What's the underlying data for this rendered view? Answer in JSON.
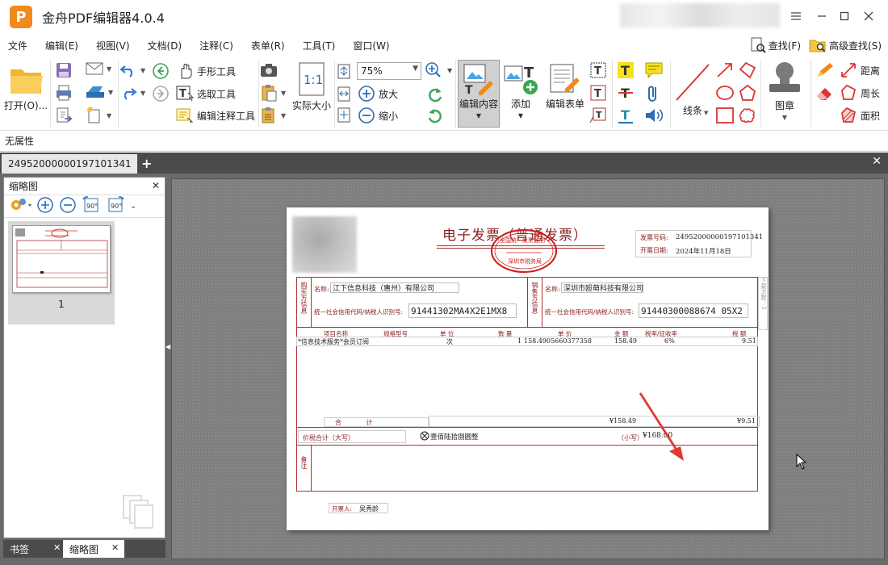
{
  "app": {
    "logo_letter": "P",
    "title": "金舟PDF编辑器4.0.4"
  },
  "menu": {
    "items": [
      "文件",
      "编辑(E)",
      "视图(V)",
      "文档(D)",
      "注释(C)",
      "表单(R)",
      "工具(T)",
      "窗口(W)"
    ],
    "find": "查找(F)",
    "advanced_find": "高级查找(S)"
  },
  "ribbon": {
    "open": "打开(O)...",
    "hand_tool": "手形工具",
    "select_tool": "选取工具",
    "edit_annot_tool": "编辑注释工具",
    "actual_size": "实际大小",
    "zoom_value": "75%",
    "zoom_in": "放大",
    "zoom_out": "缩小",
    "edit_content": "编辑内容",
    "add": "添加",
    "edit_form": "编辑表单",
    "lines": "线条",
    "stamp": "图章",
    "distance": "距离",
    "perimeter": "周长",
    "area": "面积"
  },
  "propbar": {
    "text": "无属性"
  },
  "doc_tab": {
    "label": "24952000000197101341"
  },
  "thumb_panel": {
    "title": "缩略图",
    "page_number": "1"
  },
  "bottom_tabs": {
    "bookmarks": "书签",
    "thumbnails": "缩略图"
  },
  "invoice": {
    "title": "电子发票（普通发票）",
    "stamp_top": "全国统一发票监制",
    "stamp_bottom": "深圳市税务局",
    "invoice_no_label": "发票号码:",
    "invoice_no": "24952000000197101341",
    "date_label": "开票日期:",
    "date": "2024年11月18日",
    "buyer_side": "购买方信息",
    "seller_side": "销售方信息",
    "name_label": "名称:",
    "buyer_name": "江下信息科技（惠州）有限公司",
    "seller_name": "深圳市殴萌科技有限公司",
    "tax_id_label": "统一社会信用代码/纳税人识别号:",
    "buyer_tax_id": "91441302MA4X2E1MX8",
    "seller_tax_id": "91440300088674 05X2",
    "headers": [
      "项目名称",
      "规格型号",
      "单 位",
      "数 量",
      "单 价",
      "金 额",
      "税率/征收率",
      "税 额"
    ],
    "row": {
      "name": "*信息技术服务*会员订阅",
      "unit": "次",
      "qty": "1",
      "price": "158.4905660377358",
      "amount": "158.49",
      "rate": "6%",
      "tax": "9.51"
    },
    "total_label": "合 计",
    "total_amount": "¥158.49",
    "total_tax": "¥9.51",
    "grand_label": "价税合计（大写）",
    "grand_upper": "壹佰陆拾捌圆整",
    "grand_small_label": "（小写）",
    "grand_small": "¥168.00",
    "remarks": "备注",
    "issuer_label": "开票人:",
    "issuer": "吴秀龄",
    "side_note": "下载次数：3"
  },
  "colors": {
    "invoice_red": "#a33333",
    "arrow_red": "#e03a2f",
    "tabstrip": "#4b4b4b",
    "canvas": "#7f7f7f"
  }
}
